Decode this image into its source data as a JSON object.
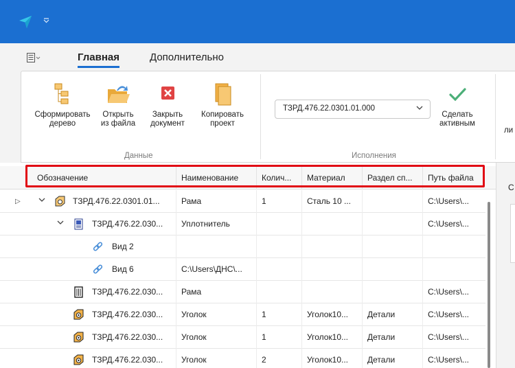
{
  "title_bar": {
    "accent": "#1b6fd1",
    "app_icon": "send-arrow-icon",
    "quick_access": "dropdown-arrow-icon"
  },
  "tabs": [
    {
      "label": "Главная",
      "active": true
    },
    {
      "label": "Дополнительно",
      "active": false
    }
  ],
  "ribbon": {
    "groups": [
      {
        "label": "Данные",
        "buttons": [
          {
            "label": "Сформировать\nдерево",
            "icon": "tree-structure-icon"
          },
          {
            "label": "Открыть\nиз файла",
            "icon": "open-folder-icon"
          },
          {
            "label": "Закрыть\nдокумент",
            "icon": "close-document-icon"
          },
          {
            "label": "Копировать\nпроект",
            "icon": "copy-project-icon"
          }
        ]
      },
      {
        "label": "Исполнения",
        "combo_value": "ТЗРД.476.22.0301.01.000",
        "buttons": [
          {
            "label": "Сделать\nактивным",
            "icon": "checkmark-icon"
          }
        ]
      }
    ],
    "cut_off_label": "ли"
  },
  "grid": {
    "columns": [
      "Обозначение",
      "Наименование",
      "Колич...",
      "Материал",
      "Раздел сп...",
      "Путь файла"
    ],
    "rows": [
      {
        "level": 0,
        "expander": "expanded",
        "row_marker": "▷",
        "icon": "assembly-icon",
        "designation": "ТЗРД.476.22.0301.01...",
        "name": "Рама",
        "qty": "1",
        "material": "Сталь 10 ...",
        "section": "",
        "path": "C:\\Users\\..."
      },
      {
        "level": 1,
        "expander": "expanded",
        "icon": "drawing-doc-icon",
        "designation": "ТЗРД.476.22.030...",
        "name": "Уплотнитель",
        "qty": "",
        "material": "",
        "section": "",
        "path": "C:\\Users\\..."
      },
      {
        "level": 2,
        "expander": "",
        "icon": "link-icon",
        "designation": "Вид 2",
        "name": "",
        "qty": "",
        "material": "",
        "section": "",
        "path": ""
      },
      {
        "level": 2,
        "expander": "",
        "icon": "link-icon",
        "designation": "Вид 6",
        "name": "C:\\Users\\ДНС\\...",
        "qty": "",
        "material": "",
        "section": "",
        "path": ""
      },
      {
        "level": 1,
        "expander": "",
        "icon": "spec-doc-icon",
        "designation": "ТЗРД.476.22.030...",
        "name": "Рама",
        "qty": "",
        "material": "",
        "section": "",
        "path": "C:\\Users\\..."
      },
      {
        "level": 1,
        "expander": "",
        "icon": "part-icon",
        "designation": "ТЗРД.476.22.030...",
        "name": "Уголок",
        "qty": "1",
        "material": "Уголок10...",
        "section": "Детали",
        "path": "C:\\Users\\..."
      },
      {
        "level": 1,
        "expander": "",
        "icon": "part-icon",
        "designation": "ТЗРД.476.22.030...",
        "name": "Уголок",
        "qty": "1",
        "material": "Уголок10...",
        "section": "Детали",
        "path": "C:\\Users\\..."
      },
      {
        "level": 1,
        "expander": "",
        "icon": "part-icon",
        "designation": "ТЗРД.476.22.030...",
        "name": "Уголок",
        "qty": "2",
        "material": "Уголок10...",
        "section": "Детали",
        "path": "C:\\Users\\..."
      }
    ]
  },
  "side_panel": {
    "label": "С"
  }
}
